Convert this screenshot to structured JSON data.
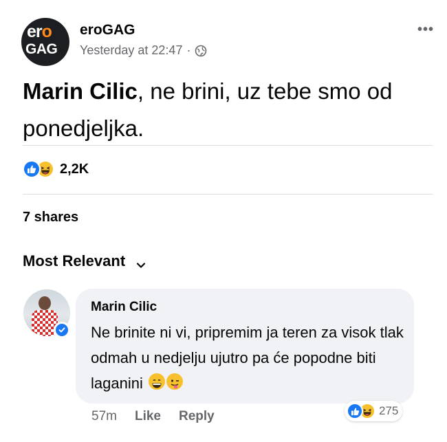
{
  "post": {
    "page_name": "eroGAG",
    "timestamp": "Yesterday at 22:47",
    "separator": "·",
    "privacy_icon": "globe-icon",
    "more_icon": "more-options-icon",
    "more_label": "•••",
    "text_mention": "Marin Cilic",
    "text_body": ", ne brini, uz tebe smo od ponedjeljka.",
    "avatar_text_line1_a": "er",
    "avatar_text_line1_b": "o",
    "avatar_text_line2": "GAG"
  },
  "reactions": {
    "types": [
      "like",
      "haha"
    ],
    "count": "2,2K"
  },
  "shares": "7 shares",
  "sort": {
    "label": "Most Relevant"
  },
  "comment": {
    "author": "Marin Cilic",
    "verified": true,
    "text": "Ne brinite ni vi, pripremim ja teren za visok tlak odmah u nedjelju ujutro pa će popodne biti laganini",
    "emojis": [
      "grinning-face",
      "winking-face-with-tongue"
    ],
    "time": "57m",
    "like_label": "Like",
    "reply_label": "Reply",
    "reaction_types": [
      "like",
      "haha"
    ],
    "reaction_count": "275"
  },
  "colors": {
    "facebook_blue": "#1877f2",
    "muted_text": "#65676b",
    "bubble_bg": "#f0f2f5",
    "haha_yellow": "#f7c12d",
    "brand_orange": "#ff8a1e"
  }
}
